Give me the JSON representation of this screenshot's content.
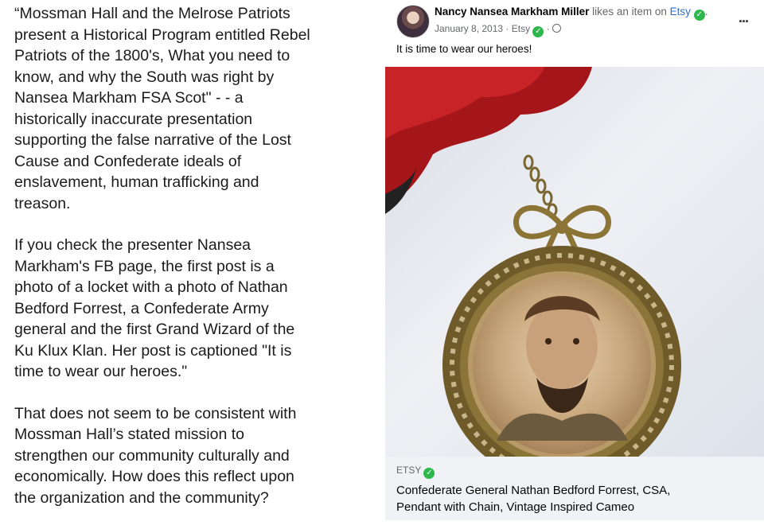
{
  "left_text": {
    "para1": "“Mossman Hall and the Melrose Patriots\npresent a Historical Program entitled Rebel\nPatriots of the 1800's, What you need to\nknow, and why the South was right by\nNansea Markham FSA Scot\" - - a\nhistorically inaccurate presentation\nsupporting the false narrative of the Lost\nCause and Confederate ideals of\nenslavement, human trafficking and\ntreason.",
    "para2": "If you check the presenter Nansea\nMarkham's FB page, the first post is a\nphoto of a locket with a photo of Nathan\nBedford Forrest, a Confederate Army\ngeneral and the first Grand Wizard of the\nKu Klux Klan. Her post is captioned \"It is\ntime to wear our heroes.\"",
    "para3": "That does not seem to be consistent with\nMossman Hall’s stated mission to\nstrengthen our community culturally and\neconomically.   How does this reflect upon\nthe organization and the community?"
  },
  "post": {
    "author": "Nancy Nansea Markham Miller",
    "action": "likes an item on",
    "site": "Etsy",
    "date": "January 8, 2013",
    "via": "Etsy",
    "more": "...",
    "caption": "It is time to wear our heroes!",
    "link_source": "ETSY",
    "link_title": "Confederate General Nathan Bedford Forrest, CSA,\nPendant with Chain, Vintage Inspired Cameo"
  },
  "icons": {
    "verified": "verified-check-icon",
    "privacy": "globe-icon",
    "menu": "more-options-icon"
  }
}
